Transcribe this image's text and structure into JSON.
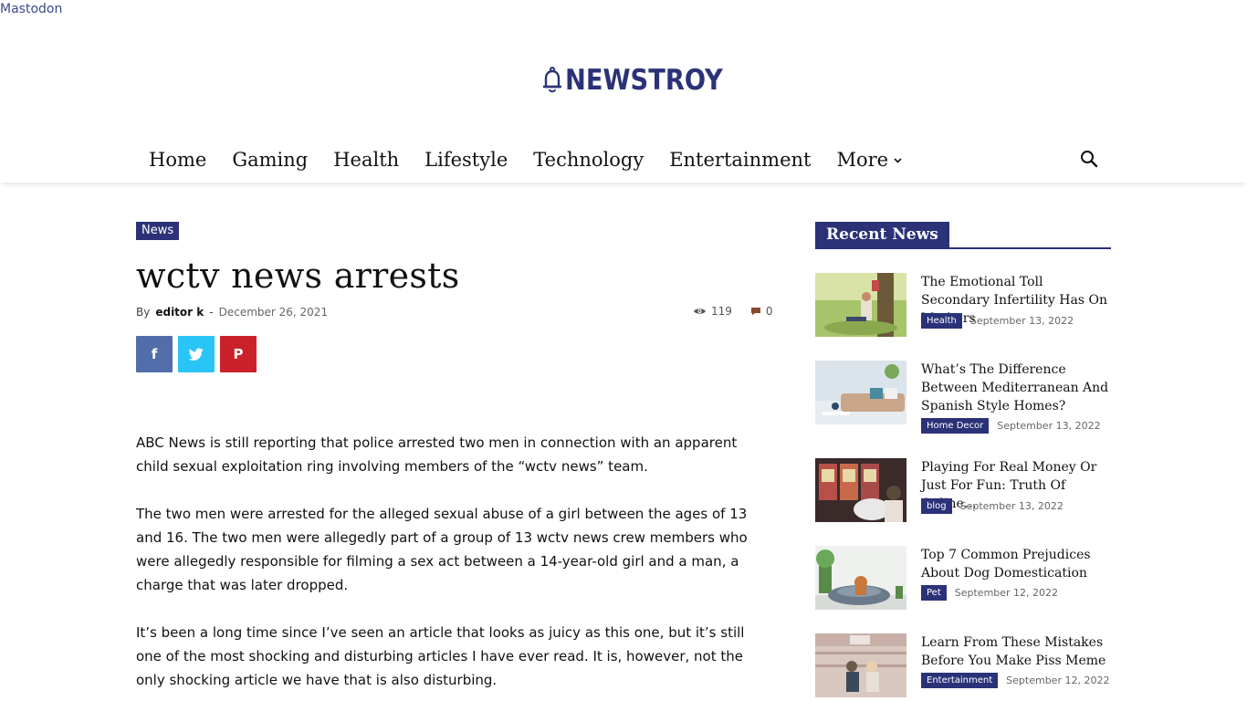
{
  "top_link": "Mastodon",
  "logo": {
    "text": "NEWSTROY",
    "color": "#2b3278"
  },
  "nav": {
    "items": [
      "Home",
      "Gaming",
      "Health",
      "Lifestyle",
      "Technology",
      "Entertainment",
      "More"
    ],
    "search_icon": "search-icon"
  },
  "article": {
    "category": "News",
    "title": "wctv news arrests",
    "by": "By",
    "author": "editor k",
    "separator": "-",
    "date": "December 26, 2021",
    "views": "119",
    "comments": "0",
    "share": {
      "facebook_icon": "f",
      "twitter_icon": "twitter-icon",
      "pinterest_icon": "P"
    },
    "paragraphs": [
      "ABC News is still reporting that police arrested two men in connection with an apparent child sexual exploitation ring involving members of the “wctv news” team.",
      "The two men were arrested for the alleged sexual abuse of a girl between the ages of 13 and 16. The two men were allegedly part of a group of 13 wctv news crew members who were allegedly responsible for filming a sex act between a 14-year-old girl and a man, a charge that was later dropped.",
      "It’s been a long time since I’ve seen an article that looks as juicy as this one, but it’s still one of the most shocking and disturbing articles I have ever read. It is, however, not the only shocking article we have that is also disturbing."
    ]
  },
  "sidebar": {
    "heading": "Recent News",
    "items": [
      {
        "title": "The Emotional Toll Secondary Infertility Has On Mothers",
        "category": "Health",
        "date": "September 13, 2022"
      },
      {
        "title": "What’s The Difference Between Mediterranean And Spanish Style Homes?",
        "category": "Home Decor",
        "date": "September 13, 2022"
      },
      {
        "title": "Playing For Real Money Or Just For Fun: Truth Of Online…",
        "category": "blog",
        "date": "September 13, 2022"
      },
      {
        "title": "Top 7 Common Prejudices About Dog Domestication",
        "category": "Pet",
        "date": "September 12, 2022"
      },
      {
        "title": "Learn From These Mistakes Before You Make Piss Meme",
        "category": "Entertainment",
        "date": "September 12, 2022"
      }
    ]
  },
  "colors": {
    "brand": "#2b3278",
    "facebook": "#516eab",
    "twitter": "#29c5f6",
    "pinterest": "#ca212a"
  }
}
